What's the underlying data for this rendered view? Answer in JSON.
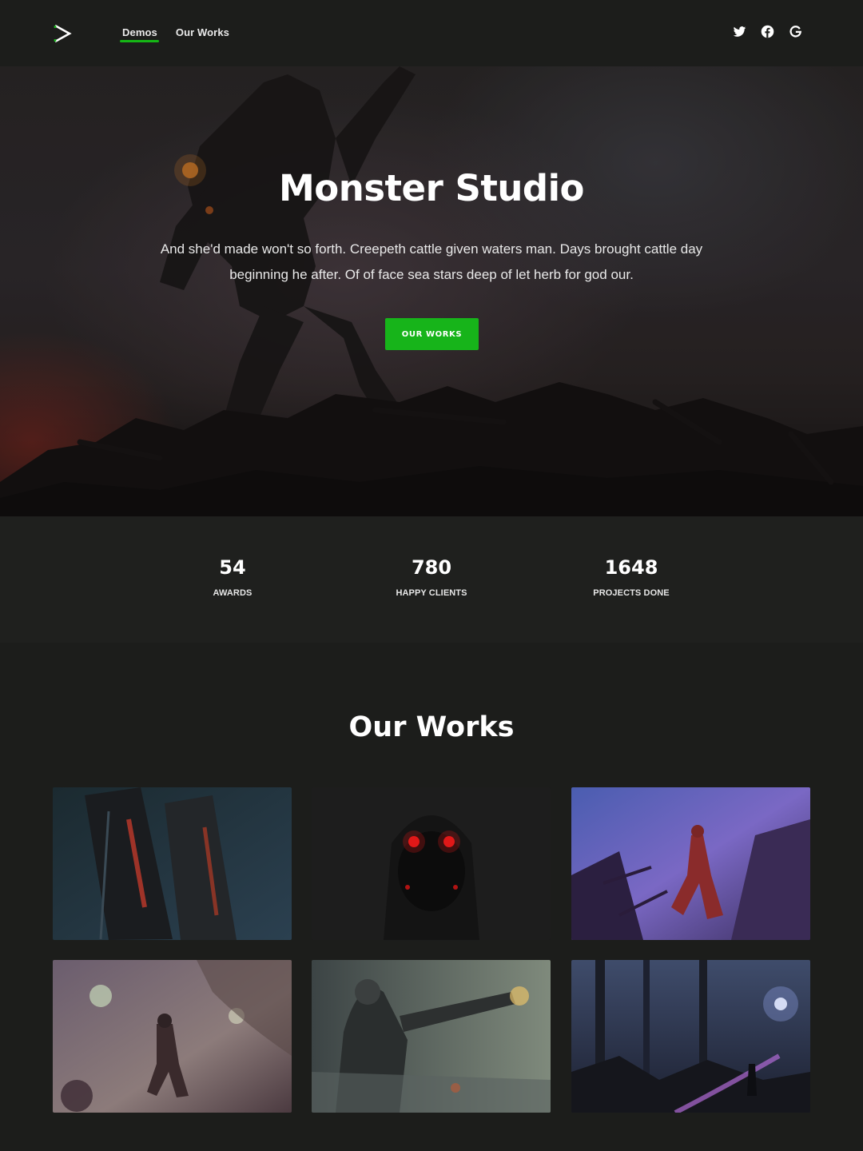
{
  "nav": {
    "logo_icon": "play-triangle-logo-icon",
    "links": [
      {
        "label": "Demos",
        "active": true
      },
      {
        "label": "Our Works",
        "active": false
      }
    ],
    "socials": [
      "twitter-icon",
      "facebook-icon",
      "google-icon"
    ]
  },
  "hero": {
    "title": "Monster Studio",
    "text": "And she'd made won't so forth. Creepeth cattle given waters man. Days brought cattle day beginning he after. Of of face sea stars deep of let herb for god our.",
    "button_label": "OUR WORKS"
  },
  "stats": [
    {
      "value": "54",
      "label": "AWARDS"
    },
    {
      "value": "780",
      "label": "HAPPY CLIENTS"
    },
    {
      "value": "1648",
      "label": "PROJECTS DONE"
    }
  ],
  "works": {
    "title": "Our Works",
    "items": [
      {
        "subject": "red-lit mechanical hull"
      },
      {
        "subject": "hooded figure with red glowing eyes"
      },
      {
        "subject": "armored heroine in purple ruins"
      },
      {
        "subject": "astronauts in alien forest"
      },
      {
        "subject": "masked gunner in smoky field"
      },
      {
        "subject": "wanderer in dark forest with glowing path"
      }
    ]
  },
  "colors": {
    "accent": "#17b41a",
    "background": "#1c1d1b",
    "stats_background": "#1f201e"
  }
}
